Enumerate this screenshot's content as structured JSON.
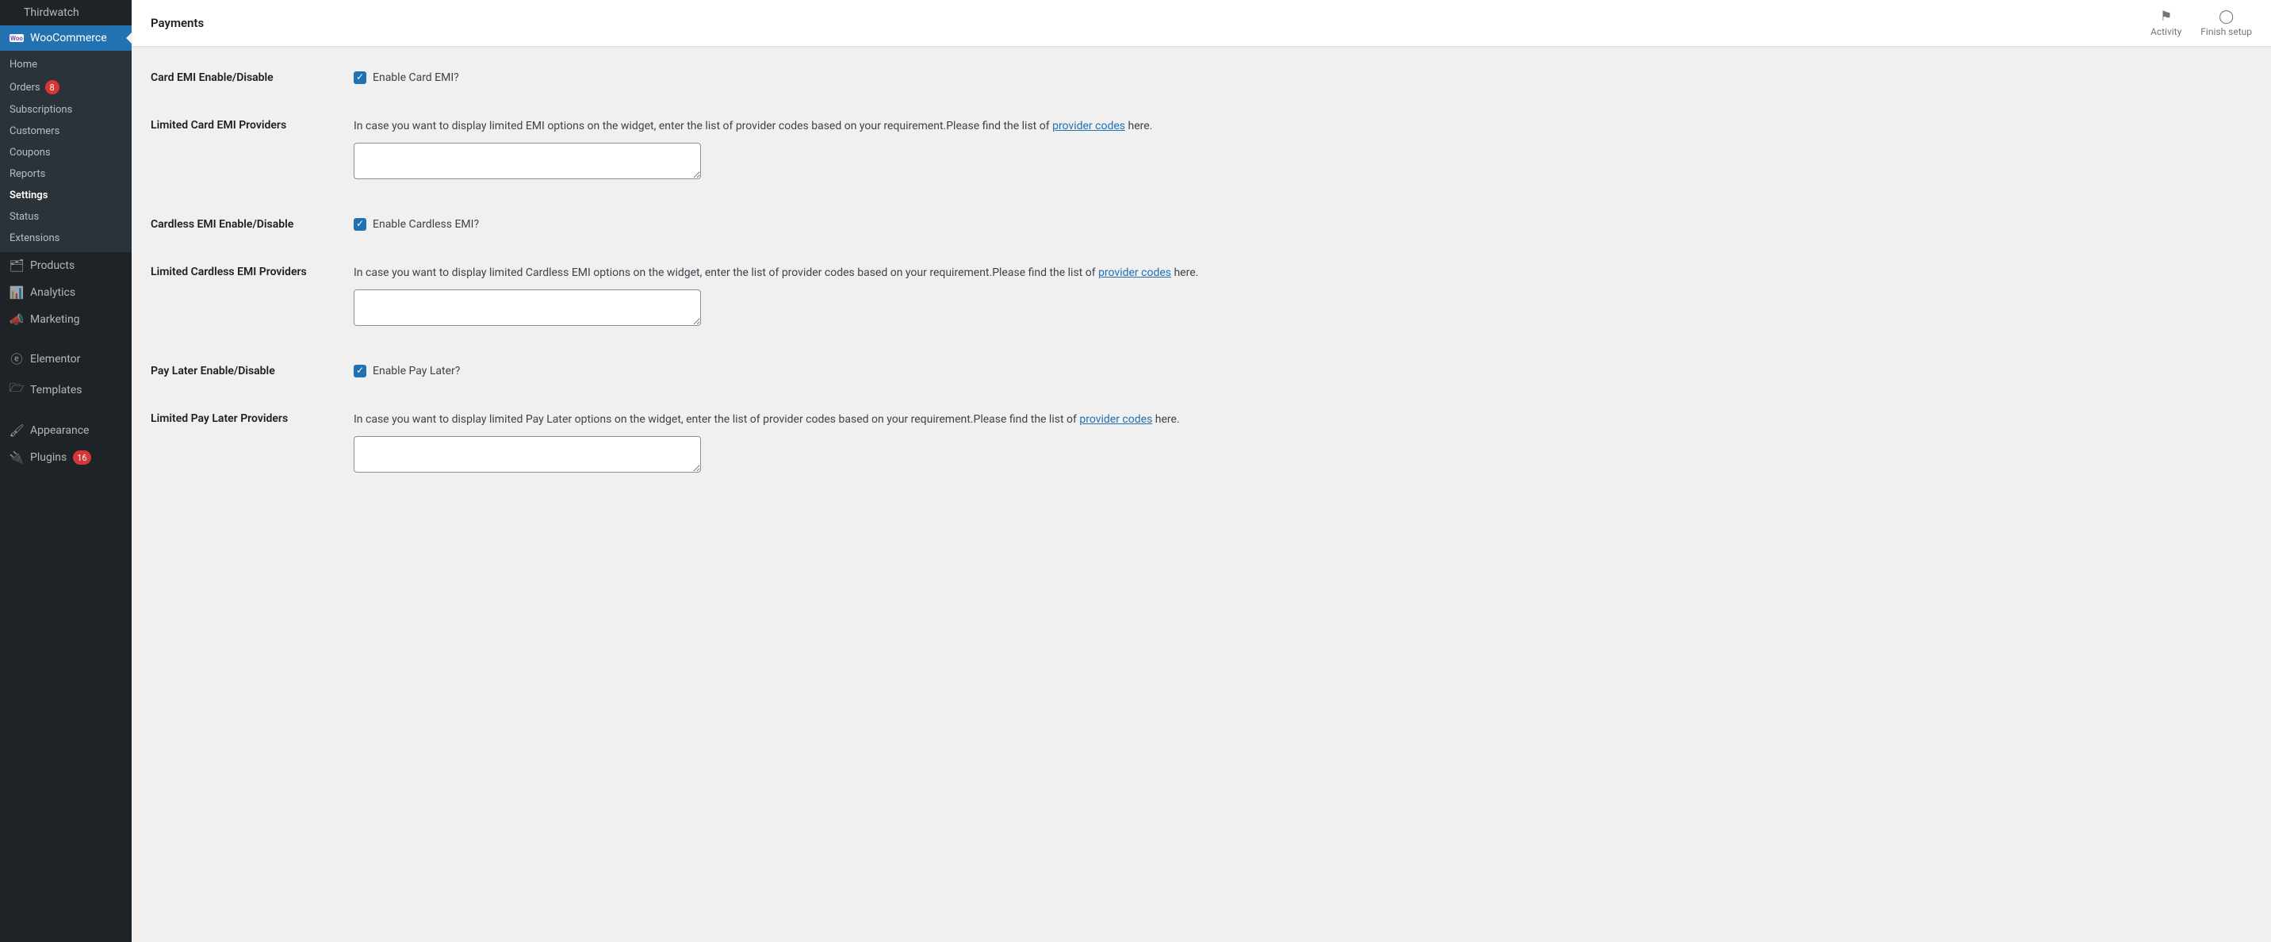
{
  "sidebar": {
    "truncated_item": "Thirdwatch",
    "active_parent": "WooCommerce",
    "sub": {
      "home": "Home",
      "orders": "Orders",
      "orders_badge": "8",
      "subscriptions": "Subscriptions",
      "customers": "Customers",
      "coupons": "Coupons",
      "reports": "Reports",
      "settings": "Settings",
      "status": "Status",
      "extensions": "Extensions"
    },
    "menu": {
      "products": "Products",
      "analytics": "Analytics",
      "marketing": "Marketing",
      "elementor": "Elementor",
      "templates": "Templates",
      "appearance": "Appearance",
      "plugins": "Plugins",
      "plugins_badge": "16"
    }
  },
  "topbar": {
    "title": "Payments",
    "activity": "Activity",
    "finish_setup": "Finish setup"
  },
  "form": {
    "card_emi": {
      "label": "Card EMI Enable/Disable",
      "checkbox_label": "Enable Card EMI?"
    },
    "limited_card": {
      "label": "Limited Card EMI Providers",
      "desc_pre": "In case you want to display limited EMI options on the widget, enter the list of provider codes based on your requirement.Please find the list of ",
      "link": "provider codes",
      "desc_post": " here."
    },
    "cardless_emi": {
      "label": "Cardless EMI Enable/Disable",
      "checkbox_label": "Enable Cardless EMI?"
    },
    "limited_cardless": {
      "label": "Limited Cardless EMI Providers",
      "desc_pre": "In case you want to display limited Cardless EMI options on the widget, enter the list of provider codes based on your requirement.Please find the list of ",
      "link": "provider codes",
      "desc_post": " here."
    },
    "pay_later": {
      "label": "Pay Later Enable/Disable",
      "checkbox_label": "Enable Pay Later?"
    },
    "limited_pay_later": {
      "label": "Limited Pay Later Providers",
      "desc_pre": "In case you want to display limited Pay Later options on the widget, enter the list of provider codes based on your requirement.Please find the list of ",
      "link": "provider codes",
      "desc_post": " here."
    }
  }
}
